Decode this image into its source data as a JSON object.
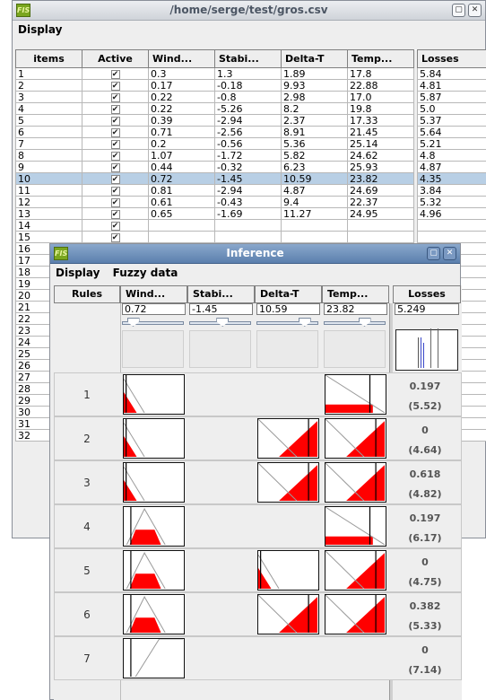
{
  "main_window": {
    "title": "/home/serge/test/gros.csv",
    "menu": [
      "Display"
    ],
    "columns": [
      "items",
      "Active",
      "Wind...",
      "Stabi...",
      "Delta-T",
      "Temp...",
      "Losses"
    ],
    "rows": [
      [
        "1",
        "0.3",
        "1.3",
        "1.89",
        "17.8",
        "5.84"
      ],
      [
        "2",
        "0.17",
        "-0.18",
        "9.93",
        "22.88",
        "4.81"
      ],
      [
        "3",
        "0.22",
        "-0.8",
        "2.98",
        "17.0",
        "5.87"
      ],
      [
        "4",
        "0.22",
        "-5.26",
        "8.2",
        "19.8",
        "5.0"
      ],
      [
        "5",
        "0.39",
        "-2.94",
        "2.37",
        "17.33",
        "5.37"
      ],
      [
        "6",
        "0.71",
        "-2.56",
        "8.91",
        "21.45",
        "5.64"
      ],
      [
        "7",
        "0.2",
        "-0.56",
        "5.36",
        "25.14",
        "5.21"
      ],
      [
        "8",
        "1.07",
        "-1.72",
        "5.82",
        "24.62",
        "4.8"
      ],
      [
        "9",
        "0.44",
        "-0.32",
        "6.23",
        "25.93",
        "4.87"
      ],
      [
        "10",
        "0.72",
        "-1.45",
        "10.59",
        "23.82",
        "4.35"
      ],
      [
        "11",
        "0.81",
        "-2.94",
        "4.87",
        "24.69",
        "3.84"
      ],
      [
        "12",
        "0.61",
        "-0.43",
        "9.4",
        "22.37",
        "5.32"
      ],
      [
        "13",
        "0.65",
        "-1.69",
        "11.27",
        "24.95",
        "4.96"
      ],
      [
        "14",
        "",
        "",
        "",
        "",
        ""
      ],
      [
        "15",
        "",
        "",
        "",
        "",
        ""
      ],
      [
        "16",
        "",
        "",
        "",
        "",
        ""
      ],
      [
        "17",
        "",
        "",
        "",
        "",
        ""
      ],
      [
        "18",
        "",
        "",
        "",
        "",
        ""
      ],
      [
        "19",
        "",
        "",
        "",
        "",
        ""
      ],
      [
        "20",
        "",
        "",
        "",
        "",
        ""
      ],
      [
        "21",
        "",
        "",
        "",
        "",
        ""
      ],
      [
        "22",
        "",
        "",
        "",
        "",
        ""
      ],
      [
        "23",
        "",
        "",
        "",
        "",
        ""
      ],
      [
        "24",
        "",
        "",
        "",
        "",
        ""
      ],
      [
        "25",
        "",
        "",
        "",
        "",
        ""
      ],
      [
        "26",
        "",
        "",
        "",
        "",
        ""
      ],
      [
        "27",
        "",
        "",
        "",
        "",
        ""
      ],
      [
        "28",
        "",
        "",
        "",
        "",
        ""
      ],
      [
        "29",
        "",
        "",
        "",
        "",
        ""
      ],
      [
        "30",
        "",
        "",
        "",
        "",
        ""
      ],
      [
        "31",
        "",
        "",
        "",
        "",
        ""
      ],
      [
        "32",
        "",
        "",
        "",
        "",
        ""
      ]
    ],
    "active_mark": "✔",
    "selected_row": "10"
  },
  "inference_window": {
    "title": "Inference",
    "menu": [
      "Display",
      "Fuzzy data"
    ],
    "columns": [
      "Rules",
      "Wind...",
      "Stabi...",
      "Delta-T",
      "Temp...",
      "Losses"
    ],
    "inputs": [
      "0.72",
      "-1.45",
      "10.59",
      "23.82"
    ],
    "output_value": "5.249",
    "slider_levels": [
      0.1,
      0.55,
      0.85,
      0.7
    ],
    "rules": [
      {
        "id": "1",
        "degree": "0.197",
        "conclusion": "(5.52)"
      },
      {
        "id": "2",
        "degree": "0",
        "conclusion": "(4.64)"
      },
      {
        "id": "3",
        "degree": "0.618",
        "conclusion": "(4.82)"
      },
      {
        "id": "4",
        "degree": "0.197",
        "conclusion": "(6.17)"
      },
      {
        "id": "5",
        "degree": "0",
        "conclusion": "(4.75)"
      },
      {
        "id": "6",
        "degree": "0.382",
        "conclusion": "(5.33)"
      },
      {
        "id": "7",
        "degree": "0",
        "conclusion": "(7.14)"
      }
    ],
    "mf_shapes": [
      [
        "low",
        "",
        "",
        "low"
      ],
      [
        "low",
        "",
        "high",
        "high"
      ],
      [
        "low",
        "",
        "high",
        "high"
      ],
      [
        "mid",
        "",
        "",
        "low"
      ],
      [
        "mid",
        "",
        "low",
        "high"
      ],
      [
        "mid",
        "",
        "high",
        "high"
      ],
      [
        "up",
        "",
        "",
        ""
      ]
    ],
    "fill_color": "#ff0000",
    "highlight_color": "#b8cfe5"
  }
}
